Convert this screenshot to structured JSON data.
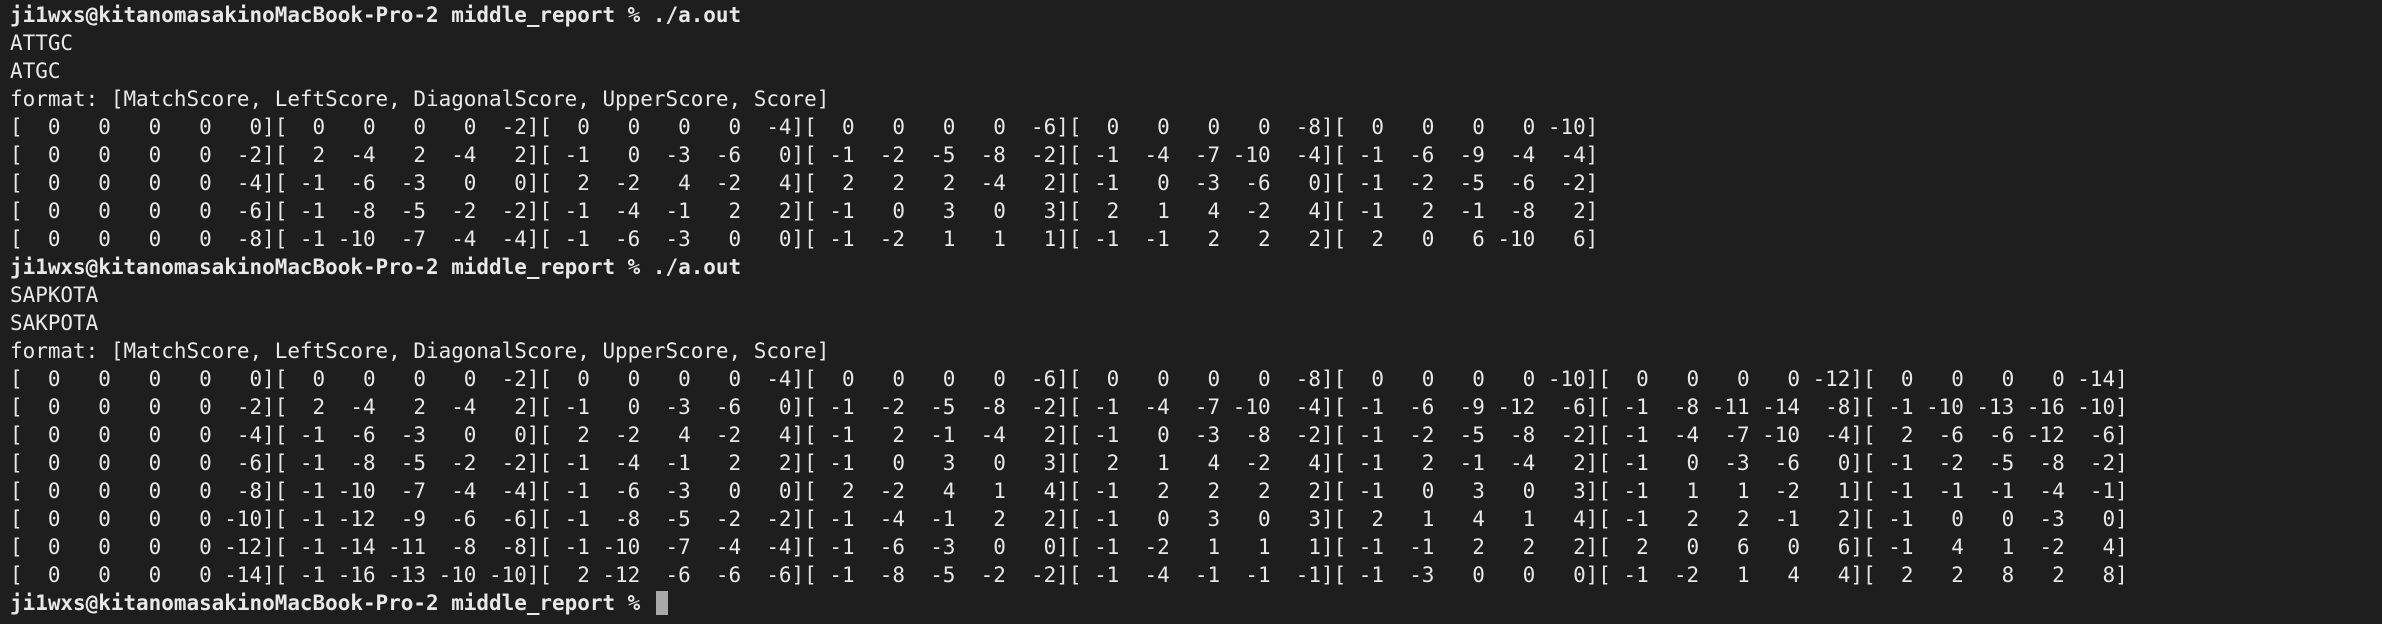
{
  "terminal": {
    "lines": [
      {
        "text": "ji1wxs@kitanomasakinoMacBook-Pro-2 middle_report % ./a.out",
        "prompt": true
      },
      {
        "text": "ATTGC"
      },
      {
        "text": "ATGC"
      },
      {
        "text": "format: [MatchScore, LeftScore, DiagonalScore, UpperScore, Score]"
      },
      {
        "text": "[  0   0   0   0   0][  0   0   0   0  -2][  0   0   0   0  -4][  0   0   0   0  -6][  0   0   0   0  -8][  0   0   0   0 -10]"
      },
      {
        "text": "[  0   0   0   0  -2][  2  -4   2  -4   2][ -1   0  -3  -6   0][ -1  -2  -5  -8  -2][ -1  -4  -7 -10  -4][ -1  -6  -9  -4  -4]"
      },
      {
        "text": "[  0   0   0   0  -4][ -1  -6  -3   0   0][  2  -2   4  -2   4][  2   2   2  -4   2][ -1   0  -3  -6   0][ -1  -2  -5  -6  -2]"
      },
      {
        "text": "[  0   0   0   0  -6][ -1  -8  -5  -2  -2][ -1  -4  -1   2   2][ -1   0   3   0   3][  2   1   4  -2   4][ -1   2  -1  -8   2]"
      },
      {
        "text": "[  0   0   0   0  -8][ -1 -10  -7  -4  -4][ -1  -6  -3   0   0][ -1  -2   1   1   1][ -1  -1   2   2   2][  2   0   6 -10   6]"
      },
      {
        "text": "ji1wxs@kitanomasakinoMacBook-Pro-2 middle_report % ./a.out",
        "prompt": true
      },
      {
        "text": "SAPKOTA"
      },
      {
        "text": "SAKPOTA"
      },
      {
        "text": "format: [MatchScore, LeftScore, DiagonalScore, UpperScore, Score]"
      },
      {
        "text": "[  0   0   0   0   0][  0   0   0   0  -2][  0   0   0   0  -4][  0   0   0   0  -6][  0   0   0   0  -8][  0   0   0   0 -10][  0   0   0   0 -12][  0   0   0   0 -14]"
      },
      {
        "text": "[  0   0   0   0  -2][  2  -4   2  -4   2][ -1   0  -3  -6   0][ -1  -2  -5  -8  -2][ -1  -4  -7 -10  -4][ -1  -6  -9 -12  -6][ -1  -8 -11 -14  -8][ -1 -10 -13 -16 -10]"
      },
      {
        "text": "[  0   0   0   0  -4][ -1  -6  -3   0   0][  2  -2   4  -2   4][ -1   2  -1  -4   2][ -1   0  -3  -8  -2][ -1  -2  -5  -8  -2][ -1  -4  -7 -10  -4][  2  -6  -6 -12  -6]"
      },
      {
        "text": "[  0   0   0   0  -6][ -1  -8  -5  -2  -2][ -1  -4  -1   2   2][ -1   0   3   0   3][  2   1   4  -2   4][ -1   2  -1  -4   2][ -1   0  -3  -6   0][ -1  -2  -5  -8  -2]"
      },
      {
        "text": "[  0   0   0   0  -8][ -1 -10  -7  -4  -4][ -1  -6  -3   0   0][  2  -2   4   1   4][ -1   2   2   2   2][ -1   0   3   0   3][ -1   1   1  -2   1][ -1  -1  -1  -4  -1]"
      },
      {
        "text": "[  0   0   0   0 -10][ -1 -12  -9  -6  -6][ -1  -8  -5  -2  -2][ -1  -4  -1   2   2][ -1   0   3   0   3][  2   1   4   1   4][ -1   2   2  -1   2][ -1   0   0  -3   0]"
      },
      {
        "text": "[  0   0   0   0 -12][ -1 -14 -11  -8  -8][ -1 -10  -7  -4  -4][ -1  -6  -3   0   0][ -1  -2   1   1   1][ -1  -1   2   2   2][  2   0   6   0   6][ -1   4   1  -2   4]"
      },
      {
        "text": "[  0   0   0   0 -14][ -1 -16 -13 -10 -10][  2 -12  -6  -6  -6][ -1  -8  -5  -2  -2][ -1  -4  -1  -1  -1][ -1  -3   0   0   0][ -1  -2   1   4   4][  2   2   8   2   8]"
      },
      {
        "text": "ji1wxs@kitanomasakinoMacBook-Pro-2 middle_report % ",
        "prompt": true,
        "cursor": true
      }
    ]
  },
  "colors": {
    "background": "#1e1e1e",
    "foreground": "#e8e8e8",
    "cursor": "#a9a9a9"
  }
}
